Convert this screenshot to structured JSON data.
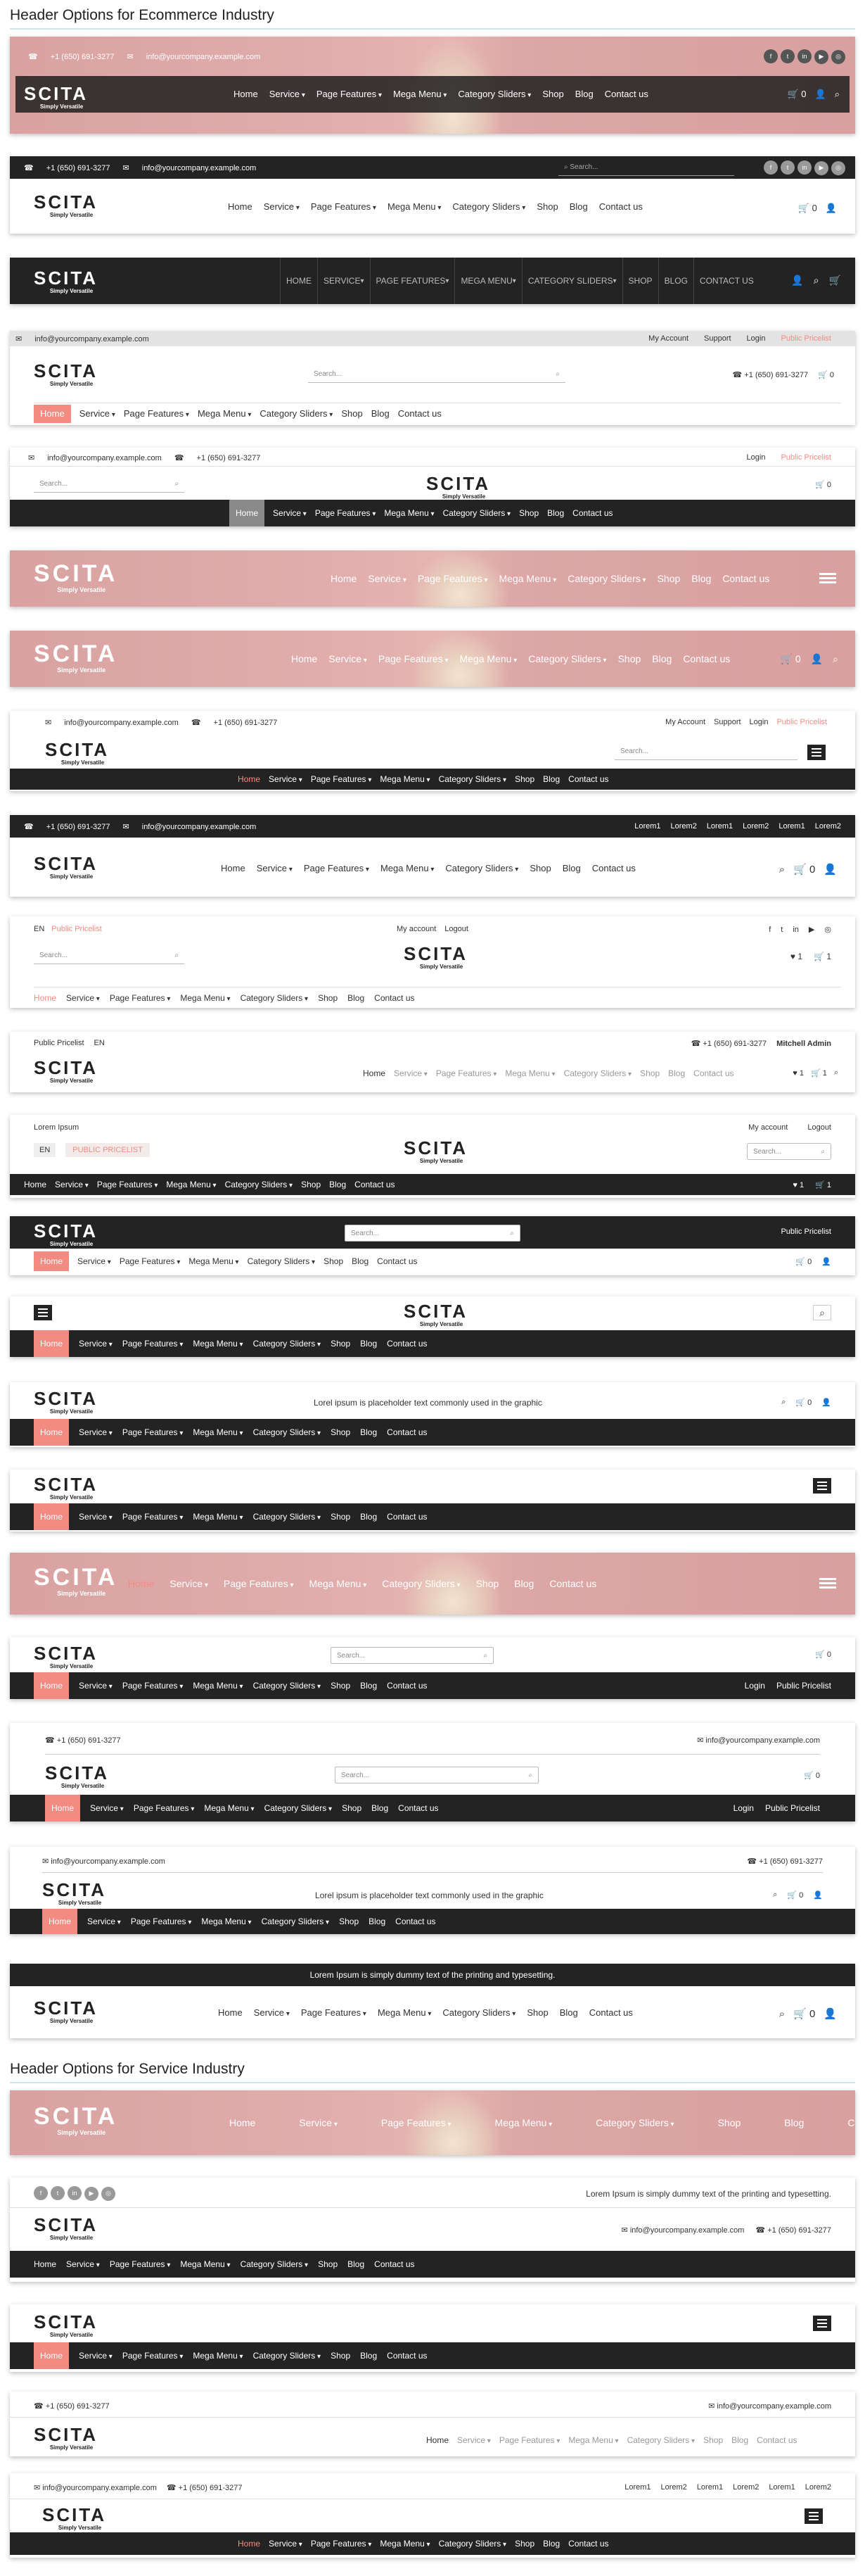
{
  "sections": {
    "ecom": "Header Options for Ecommerce Industry",
    "service": "Header Options for Service  Industry"
  },
  "brand": {
    "name": "SCITA",
    "tagline": "Simply Versatile"
  },
  "contact": {
    "phone": "+1 (650) 691-3277",
    "email": "info@yourcompany.example.com"
  },
  "nav": {
    "home": "Home",
    "service": "Service",
    "features": "Page Features",
    "mega": "Mega Menu",
    "sliders": "Category Sliders",
    "shop": "Shop",
    "blog": "Blog",
    "contact": "Contact us"
  },
  "navUpper": {
    "home": "HOME",
    "service": "SERVICE",
    "features": "PAGE FEATURES",
    "mega": "MEGA MENU",
    "sliders": "CATEGORY SLIDERS",
    "shop": "SHOP",
    "blog": "BLOG",
    "contact": "CONTACT US"
  },
  "search": {
    "placeholder": "Search..."
  },
  "account": {
    "my": "My Account",
    "support": "Support",
    "login": "Login",
    "pricelist": "Public Pricelist",
    "pricelistUpper": "PUBLIC PRICELIST",
    "myLower": "My account",
    "logout": "Logout",
    "admin": "Mitchell Admin",
    "lang": "EN"
  },
  "cart": {
    "count": "0",
    "wish": "1",
    "cart1": "1"
  },
  "lorem": {
    "short": "Lorem Ipsum",
    "placeholder": "Lorel ipsum is placeholder text commonly used in the graphic",
    "dummy": "Lorem Ipsum is simply dummy text of the printing and typesetting.",
    "l1": "Lorem1",
    "l2": "Lorem2"
  },
  "icons": {
    "phone": "☎",
    "mail": "✉",
    "cart": "🛒",
    "user": "👤",
    "search": "⌕",
    "heart": "♥"
  },
  "social": [
    "f",
    "t",
    "in",
    "▶",
    "◎"
  ],
  "colors": {
    "accent": "#f28b82",
    "dark": "#232323"
  }
}
